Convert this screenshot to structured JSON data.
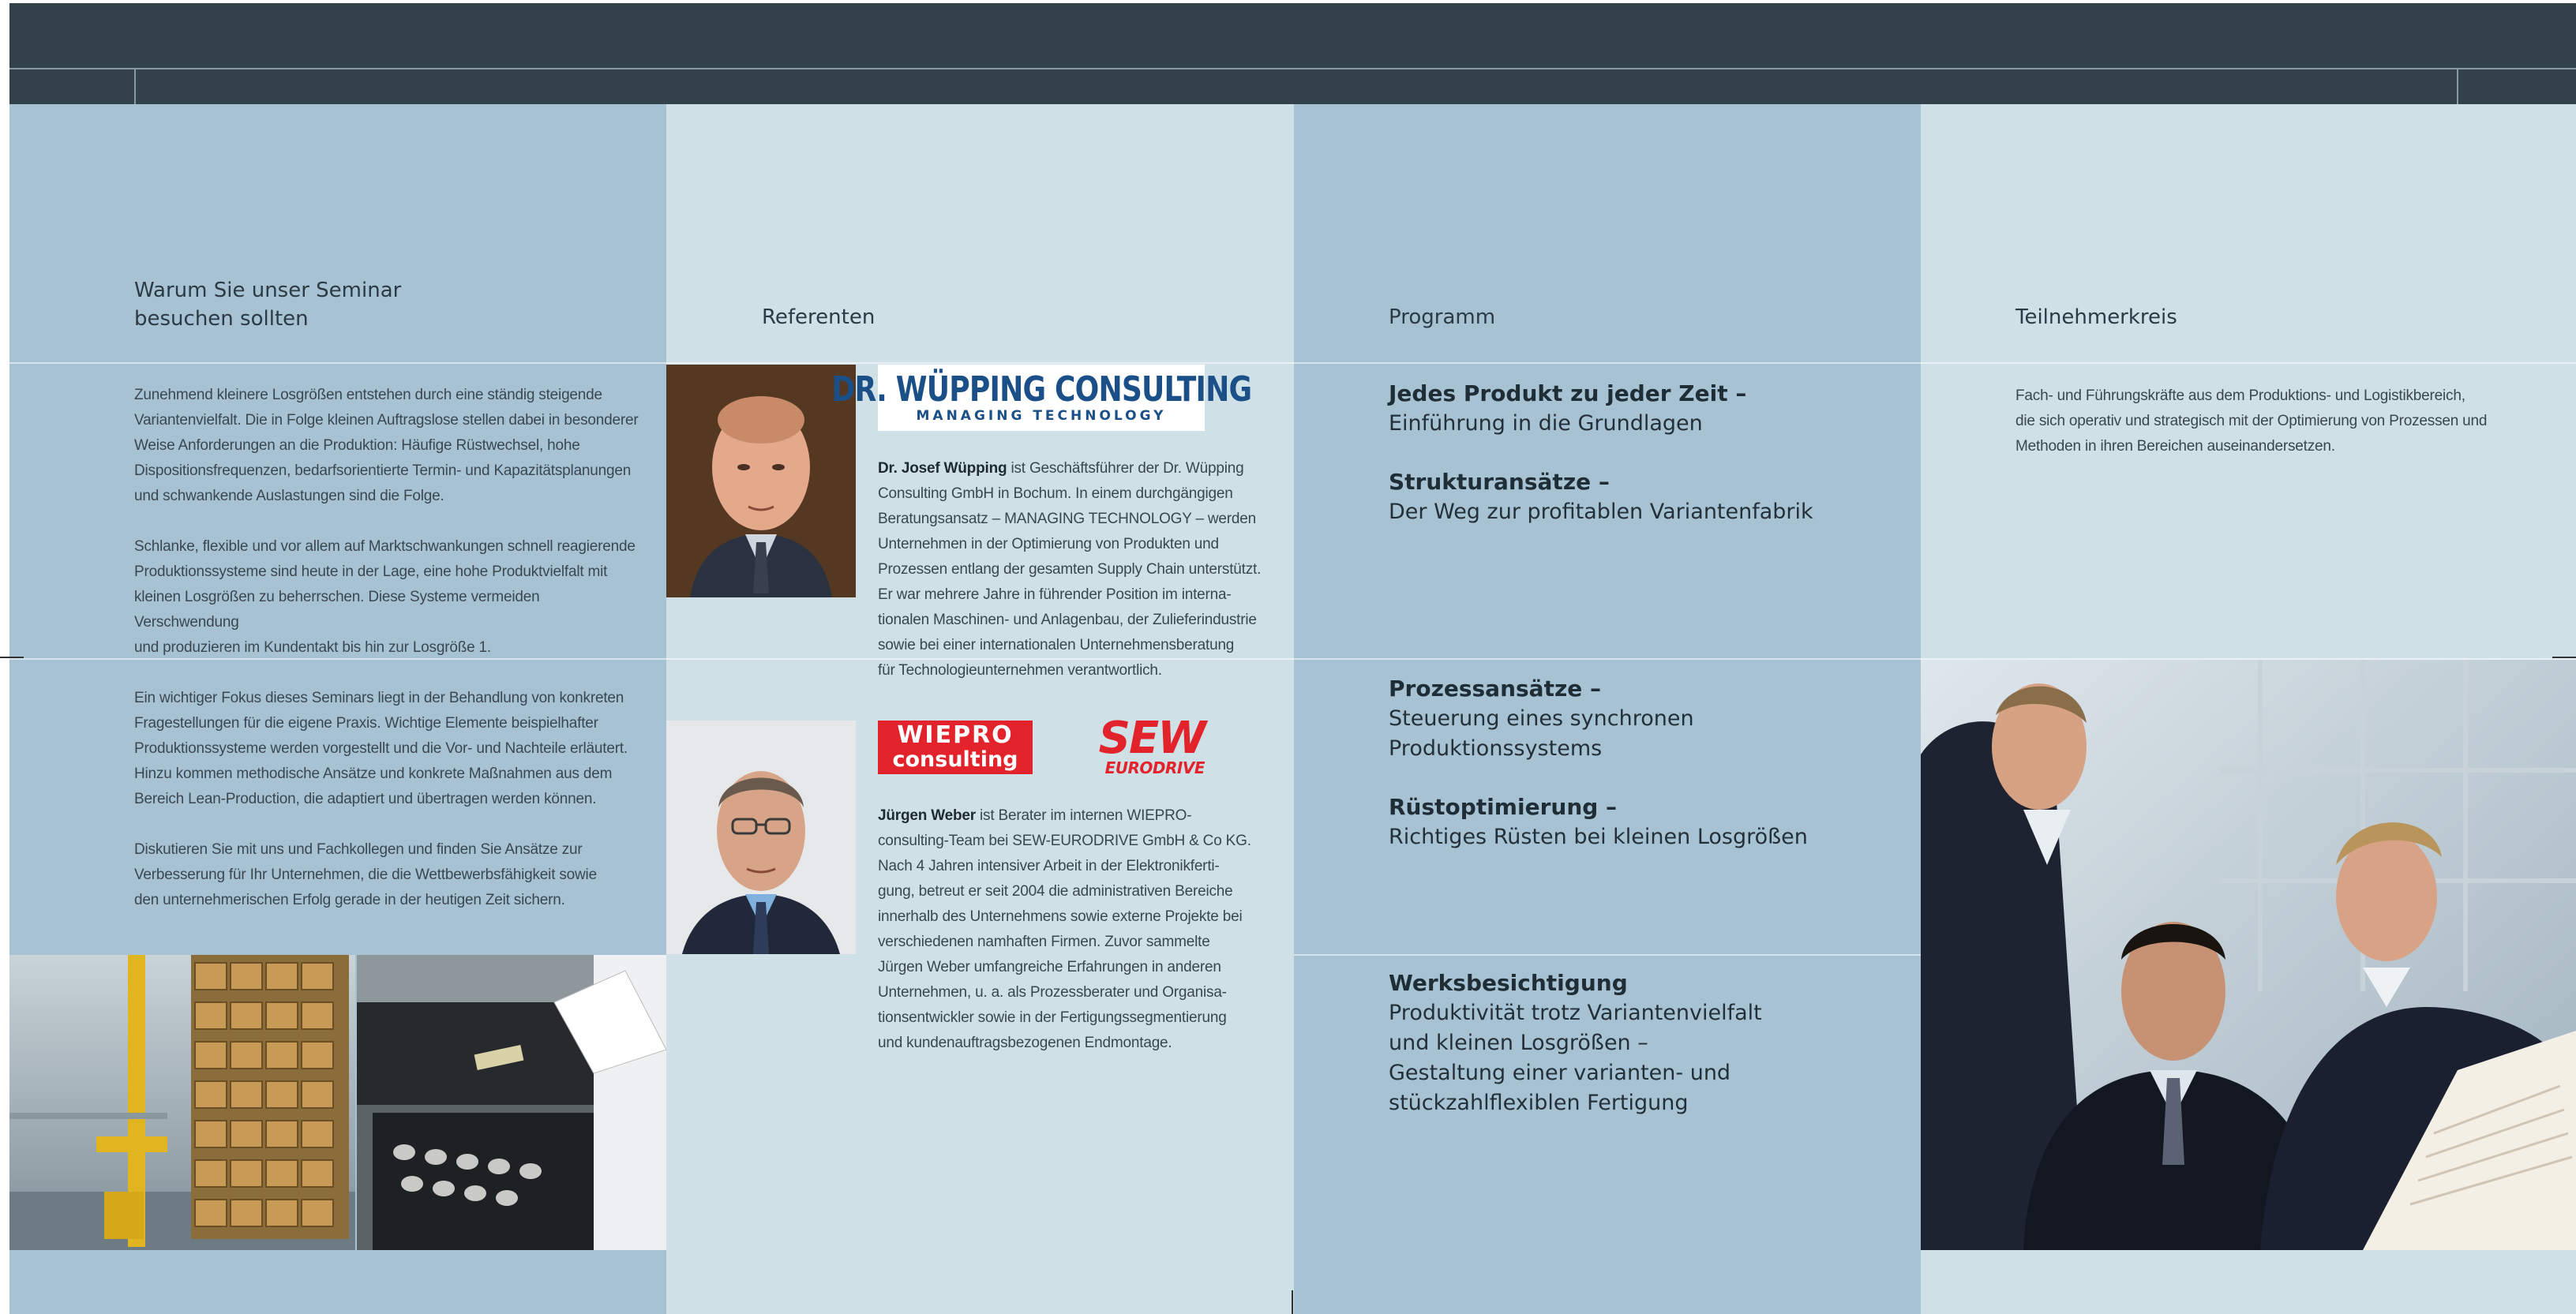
{
  "col1": {
    "heading": [
      "Warum Sie unser Seminar",
      "besuchen sollten"
    ],
    "paragraphs": [
      [
        "Zunehmend kleinere Losgrößen entstehen durch eine ständig steigende",
        "Variantenvielfalt. Die in Folge kleinen Auftragslose stellen dabei in besonderer",
        "Weise Anforderungen an die Produktion: Häufige Rüstwechsel, hohe",
        "Dispositionsfrequenzen, bedarfsorientierte Termin- und Kapazitätsplanungen",
        "und schwankende Auslastungen sind die Folge."
      ],
      [
        "Schlanke, flexible und vor allem auf Marktschwankungen schnell reagierende",
        "Produktionssysteme sind heute in der Lage, eine hohe Produktvielfalt mit",
        "kleinen Losgrößen zu beherrschen. Diese Systeme vermeiden Verschwendung",
        "und produzieren im Kundentakt bis hin zur Losgröße 1."
      ],
      [
        "Ein wichtiger Fokus dieses Seminars liegt in der Behandlung von konkreten",
        "Fragestellungen für die eigene Praxis. Wichtige Elemente beispielhafter",
        "Produktionssysteme werden vorgestellt und die Vor- und Nachteile erläutert.",
        "Hinzu kommen methodische Ansätze und konkrete Maßnahmen aus dem",
        "Bereich Lean-Production, die adaptiert und übertragen werden können."
      ],
      [
        "Diskutieren Sie mit uns und Fachkollegen und finden Sie Ansätze zur",
        "Verbesserung für Ihr Unternehmen, die die Wettbewerbsfähigkeit sowie",
        "den unternehmerischen Erfolg gerade in der heutigen Zeit sichern."
      ]
    ]
  },
  "col2": {
    "heading": "Referenten",
    "logo1": {
      "main": "DR. WÜPPING CONSULTING",
      "sub": "MANAGING TECHNOLOGY"
    },
    "speaker1": {
      "name": "Dr. Josef Wüpping",
      "lines": [
        " ist Geschäftsführer der Dr. Wüpping",
        "Consulting GmbH in Bochum. In einem durchgängigen",
        "Beratungsansatz – MANAGING TECHNOLOGY – werden",
        "Unternehmen in der Optimierung von Produkten und",
        "Prozessen entlang der gesamten Supply Chain unterstützt.",
        "Er war mehrere Jahre in führender Position im interna-",
        "tionalen Maschinen- und Anlagenbau, der Zulieferindustrie",
        "sowie bei einer internationalen Unternehmensberatung",
        "für Technologieunternehmen verantwortlich."
      ]
    },
    "logo2": {
      "line1": "WIEPRO",
      "line2": "consulting"
    },
    "logo3": {
      "line1": "SEW",
      "line2": "EURODRIVE"
    },
    "speaker2": {
      "name": "Jürgen Weber",
      "lines": [
        " ist Berater im internen WIEPRO-",
        "consulting-Team bei SEW-EURODRIVE GmbH & Co KG.",
        "Nach 4 Jahren intensiver Arbeit in der Elektronikferti-",
        "gung, betreut er seit 2004 die administrativen Bereiche",
        "innerhalb des Unternehmens sowie externe Projekte bei",
        "verschiedenen namhaften Firmen. Zuvor sammelte",
        "Jürgen Weber umfangreiche Erfahrungen in anderen",
        "Unternehmen,  u. a. als Prozessberater und Organisa-",
        "tionsentwickler sowie in der Fertigungssegmentierung",
        "und kundenauftragsbezogenen Endmontage."
      ]
    }
  },
  "col3": {
    "heading": "Programm",
    "items": [
      {
        "title": "Jedes Produkt zu jeder Zeit –",
        "sub": [
          "Einführung in die Grundlagen"
        ]
      },
      {
        "title": "Strukturansätze –",
        "sub": [
          "Der Weg zur profitablen Variantenfabrik"
        ]
      },
      {
        "title": "Prozessansätze –",
        "sub": [
          "Steuerung eines synchronen",
          "Produktionssystems"
        ]
      },
      {
        "title": "Rüstoptimierung –",
        "sub": [
          "Richtiges Rüsten bei kleinen Losgrößen"
        ]
      },
      {
        "title": "Werksbesichtigung",
        "sub": [
          "Produktivität trotz Variantenvielfalt",
          "und kleinen Losgrößen –",
          "Gestaltung einer varianten- und",
          "stückzahlflexiblen Fertigung"
        ]
      }
    ]
  },
  "col4": {
    "heading": "Teilnehmerkreis",
    "lines": [
      "Fach- und Führungskräfte aus dem Produktions- und Logistikbereich,",
      "die sich operativ und strategisch mit der Optimierung von Prozessen und",
      "Methoden in ihren Bereichen auseinandersetzen."
    ]
  },
  "colors": {
    "topbar": "#33414b",
    "panel_dark": "#a7c3d3",
    "panel_light": "#cfe0e7",
    "logo_blue": "#1b4f88",
    "logo_red": "#e2232b"
  }
}
